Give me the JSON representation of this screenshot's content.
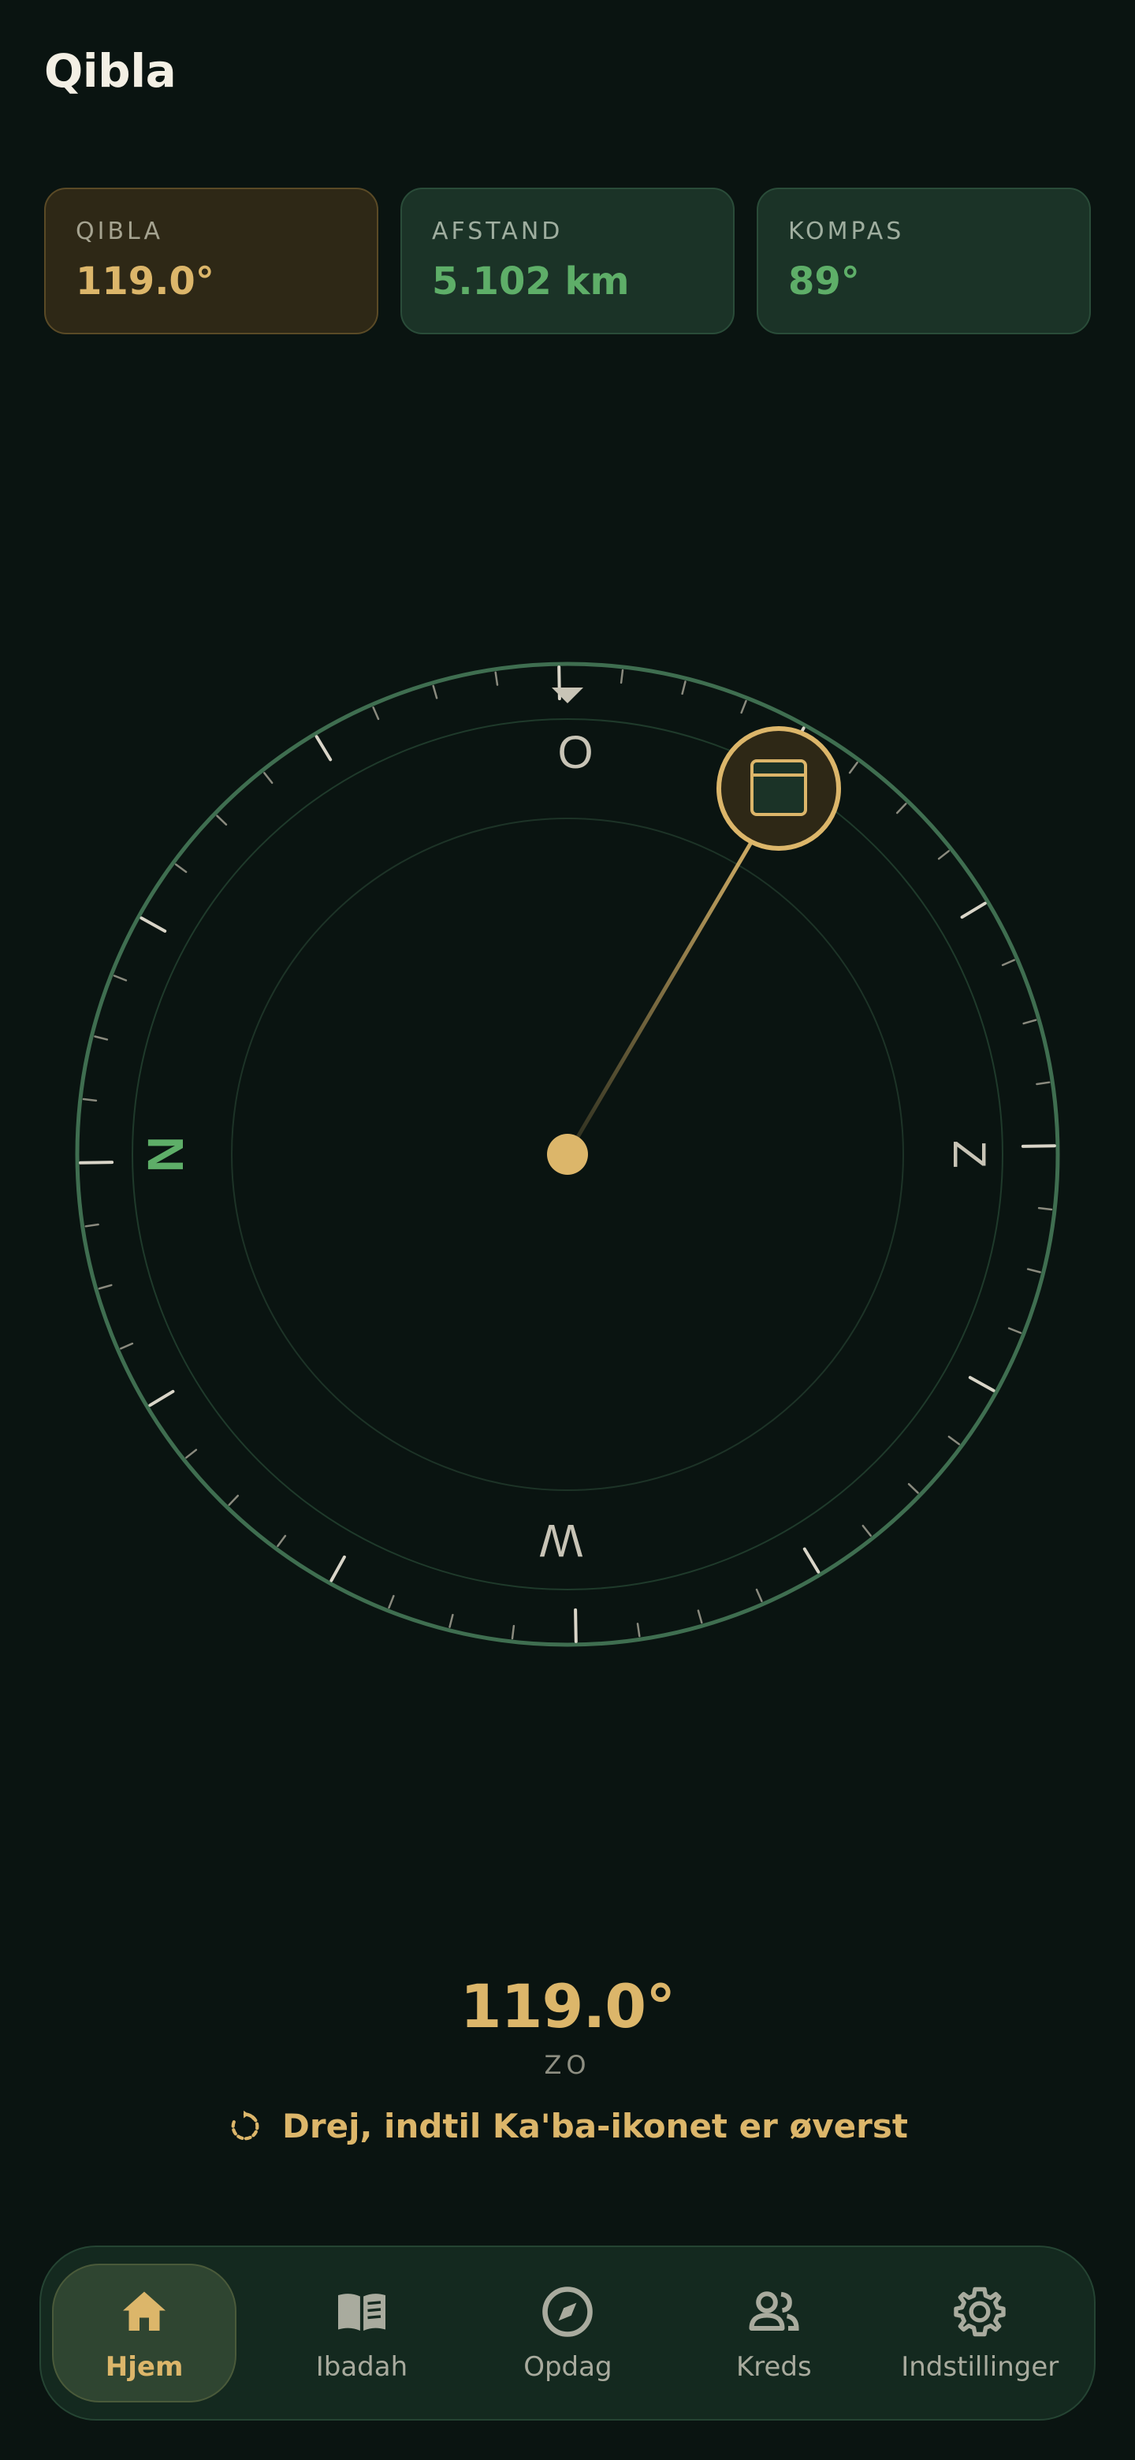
{
  "header": {
    "title": "Qibla"
  },
  "stats": [
    {
      "label": "QIBLA",
      "value": "119.0°"
    },
    {
      "label": "AFSTAND",
      "value": "5.102 km"
    },
    {
      "label": "KOMPAS",
      "value": "89°"
    }
  ],
  "compass": {
    "cardinals": {
      "north": "N",
      "east": "O",
      "south": "Z",
      "west": "W"
    },
    "qibla_bearing_deg": 119.0,
    "device_heading_deg": 89,
    "icons": {
      "qibla_marker": "kaaba-icon",
      "heading_marker": "triangle-pointer-icon"
    }
  },
  "readout": {
    "degrees": "119.0°",
    "direction": "ZO",
    "hint": "Drej, indtil Ka'ba-ikonet er øverst",
    "hint_icon": "rotate-icon"
  },
  "nav": {
    "items": [
      {
        "label": "Hjem",
        "icon": "home-icon",
        "active": true
      },
      {
        "label": "Ibadah",
        "icon": "book-icon",
        "active": false
      },
      {
        "label": "Opdag",
        "icon": "compass-icon",
        "active": false
      },
      {
        "label": "Kreds",
        "icon": "people-icon",
        "active": false
      },
      {
        "label": "Indstillinger",
        "icon": "gear-icon",
        "active": false
      }
    ]
  },
  "colors": {
    "background": "#0a1411",
    "gold": "#dcb66a",
    "green": "#5eae68",
    "ring": "#3f6e50"
  }
}
